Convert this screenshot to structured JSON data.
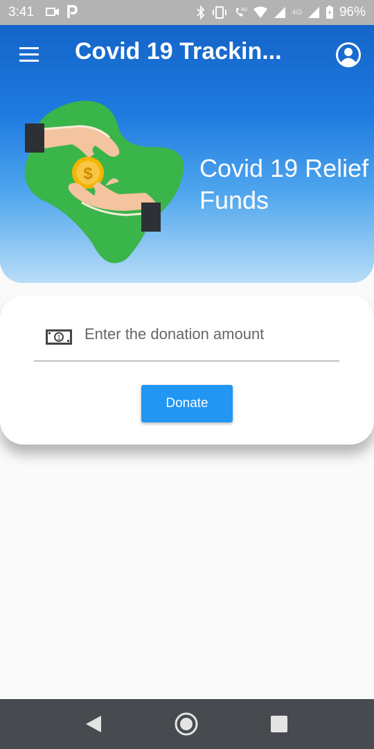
{
  "status_bar": {
    "time": "3:41",
    "battery": "96%",
    "network_label": "4G",
    "icons": [
      "video-camera-icon",
      "parking-icon",
      "bluetooth-icon",
      "vibrate-icon",
      "volte-icon",
      "wifi-icon",
      "signal-icon",
      "battery-charging-icon"
    ]
  },
  "header": {
    "title": "Covid 19 Trackin...",
    "menu_icon": "hamburger-menu-icon",
    "account_icon": "account-circle-icon",
    "hero_title": "Covid 19 Relief Funds",
    "colors": {
      "gradient_top": "#1464c8",
      "gradient_bottom": "#b9ddf7"
    }
  },
  "illustration": {
    "coin_symbol": "$"
  },
  "card": {
    "input_icon": "money-bill-icon",
    "money_icon_label": "1",
    "input_placeholder": "Enter the donation amount",
    "input_value": "",
    "donate_label": "Donate",
    "accent": "#2196f3"
  },
  "nav": {
    "back_icon": "back-triangle-icon",
    "home_icon": "home-circle-icon",
    "recents_icon": "recents-square-icon"
  }
}
